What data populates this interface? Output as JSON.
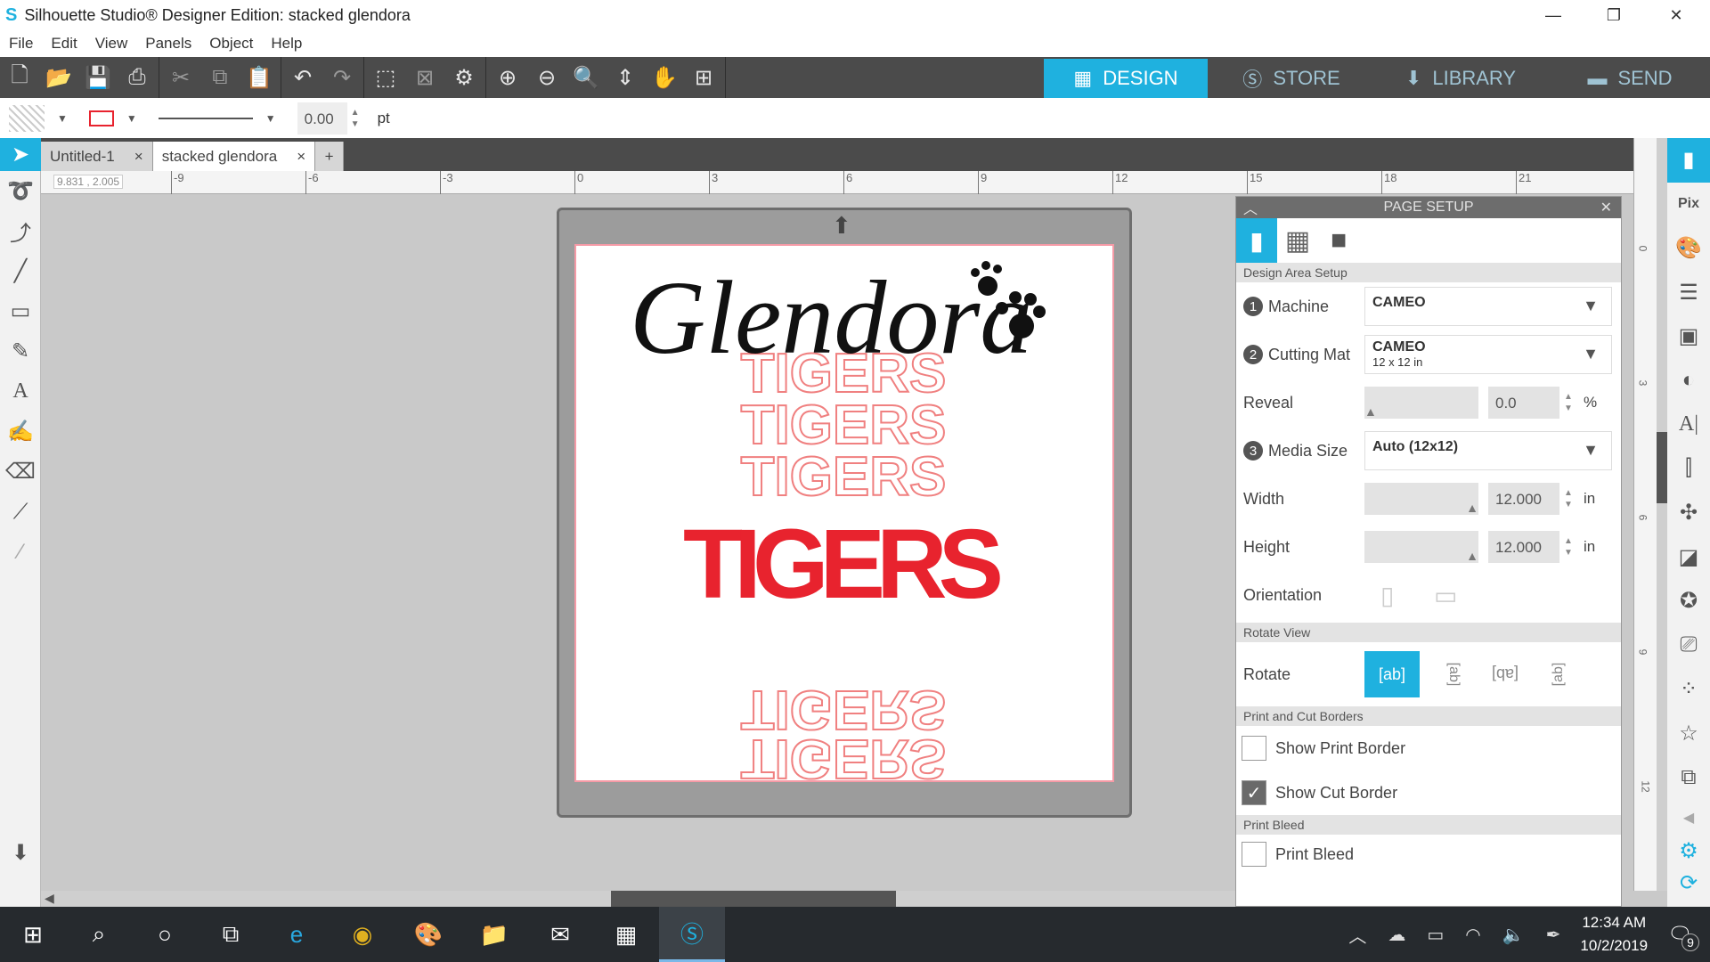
{
  "window": {
    "title": "Silhouette Studio® Designer Edition: stacked glendora"
  },
  "menu": [
    "File",
    "Edit",
    "View",
    "Panels",
    "Object",
    "Help"
  ],
  "modes": [
    {
      "label": "DESIGN",
      "icon": "grid-icon"
    },
    {
      "label": "STORE",
      "icon": "silhouette-s-icon"
    },
    {
      "label": "LIBRARY",
      "icon": "library-download-icon"
    },
    {
      "label": "SEND",
      "icon": "cutter-icon"
    }
  ],
  "propbar": {
    "line_width": "0.00",
    "unit": "pt"
  },
  "doc_tabs": [
    {
      "label": "Untitled-1",
      "close": "×"
    },
    {
      "label": "stacked glendora",
      "close": "×"
    }
  ],
  "add_tab": "+",
  "coords": "9.831 , 2.005",
  "ruler_h": [
    "-9",
    "-6",
    "-3",
    "0",
    "3",
    "6",
    "9",
    "12",
    "15",
    "18",
    "21"
  ],
  "ruler_v": [
    "0",
    "3",
    "6",
    "9",
    "12"
  ],
  "design": {
    "script": "Glendora",
    "word": "TIGERS",
    "colors": {
      "outline": "#f08080",
      "solid": "#e8232e",
      "script": "#111111"
    }
  },
  "panel": {
    "title": "PAGE SETUP",
    "section_design": "Design Area Setup",
    "machine": {
      "num": "1",
      "label": "Machine",
      "value": "CAMEO"
    },
    "mat": {
      "num": "2",
      "label": "Cutting Mat",
      "value": "CAMEO",
      "sub": "12 x 12 in"
    },
    "reveal": {
      "label": "Reveal",
      "value": "0.0",
      "unit": "%"
    },
    "media": {
      "num": "3",
      "label": "Media Size",
      "value": "Auto (12x12)"
    },
    "width": {
      "label": "Width",
      "value": "12.000",
      "unit": "in"
    },
    "height": {
      "label": "Height",
      "value": "12.000",
      "unit": "in"
    },
    "orientation": "Orientation",
    "section_rotate": "Rotate View",
    "rotate": "Rotate",
    "section_borders": "Print and Cut Borders",
    "show_print_border": {
      "label": "Show Print Border",
      "checked": false
    },
    "show_cut_border": {
      "label": "Show Cut Border",
      "checked": true
    },
    "section_bleed": "Print Bleed",
    "print_bleed": {
      "label": "Print Bleed",
      "checked": false
    }
  },
  "taskbar": {
    "time": "12:34 AM",
    "date": "10/2/2019",
    "notifications": "9"
  },
  "accent": "#1fb1df"
}
